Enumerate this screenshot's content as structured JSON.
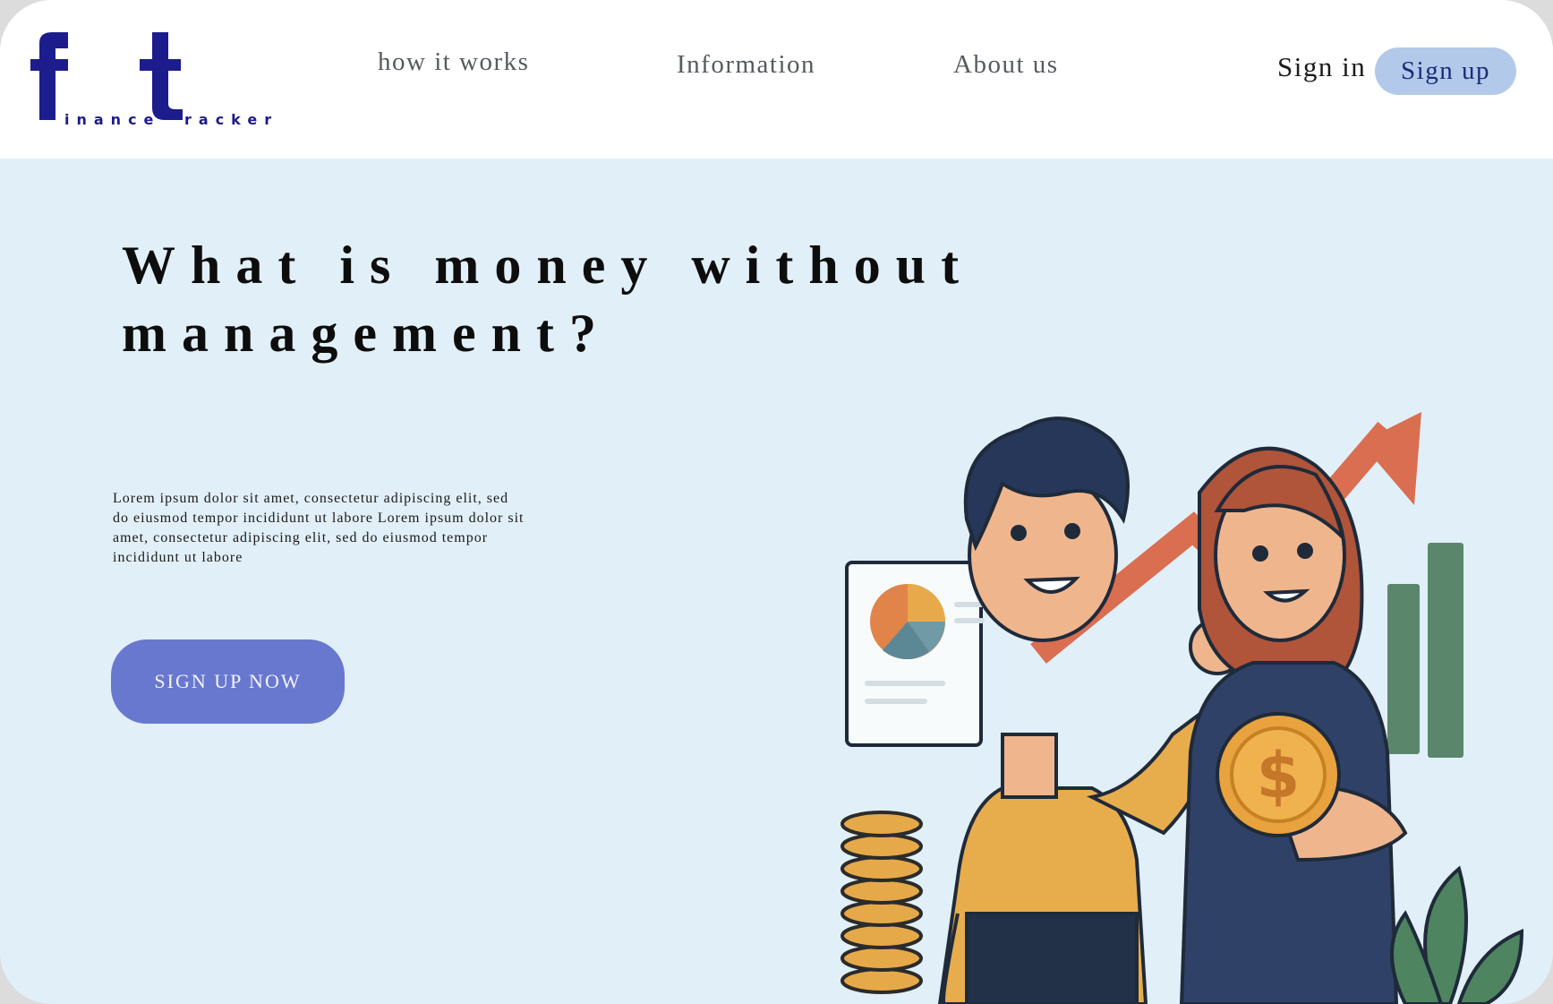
{
  "brand": {
    "logo_letter_1": "f",
    "logo_word_1": "inance",
    "logo_letter_2": "t",
    "logo_word_2": "racker",
    "color": "#1c1c8c"
  },
  "nav": {
    "items": [
      {
        "label": "how it works"
      },
      {
        "label": "Information"
      },
      {
        "label": "About us"
      }
    ],
    "sign_in": "Sign in",
    "sign_up": "Sign up"
  },
  "hero": {
    "title": "What is money without management?",
    "body": "Lorem ipsum dolor sit amet, consectetur adipiscing elit, sed do eiusmod tempor incididunt ut labore Lorem ipsum dolor sit amet, consectetur adipiscing elit, sed do eiusmod tempor incididunt ut labore",
    "cta": "SIGN UP NOW"
  },
  "colors": {
    "header_bg": "#ffffff",
    "hero_bg": "#e1eff8",
    "cta_bg": "#6878cf",
    "signup_bg": "#b3c9ea"
  },
  "illustration": {
    "icons": [
      "pie-chart-icon",
      "trend-arrow-icon",
      "bar-chart-icon",
      "coin-stack-icon",
      "dollar-coin-icon",
      "plant-icon"
    ]
  }
}
